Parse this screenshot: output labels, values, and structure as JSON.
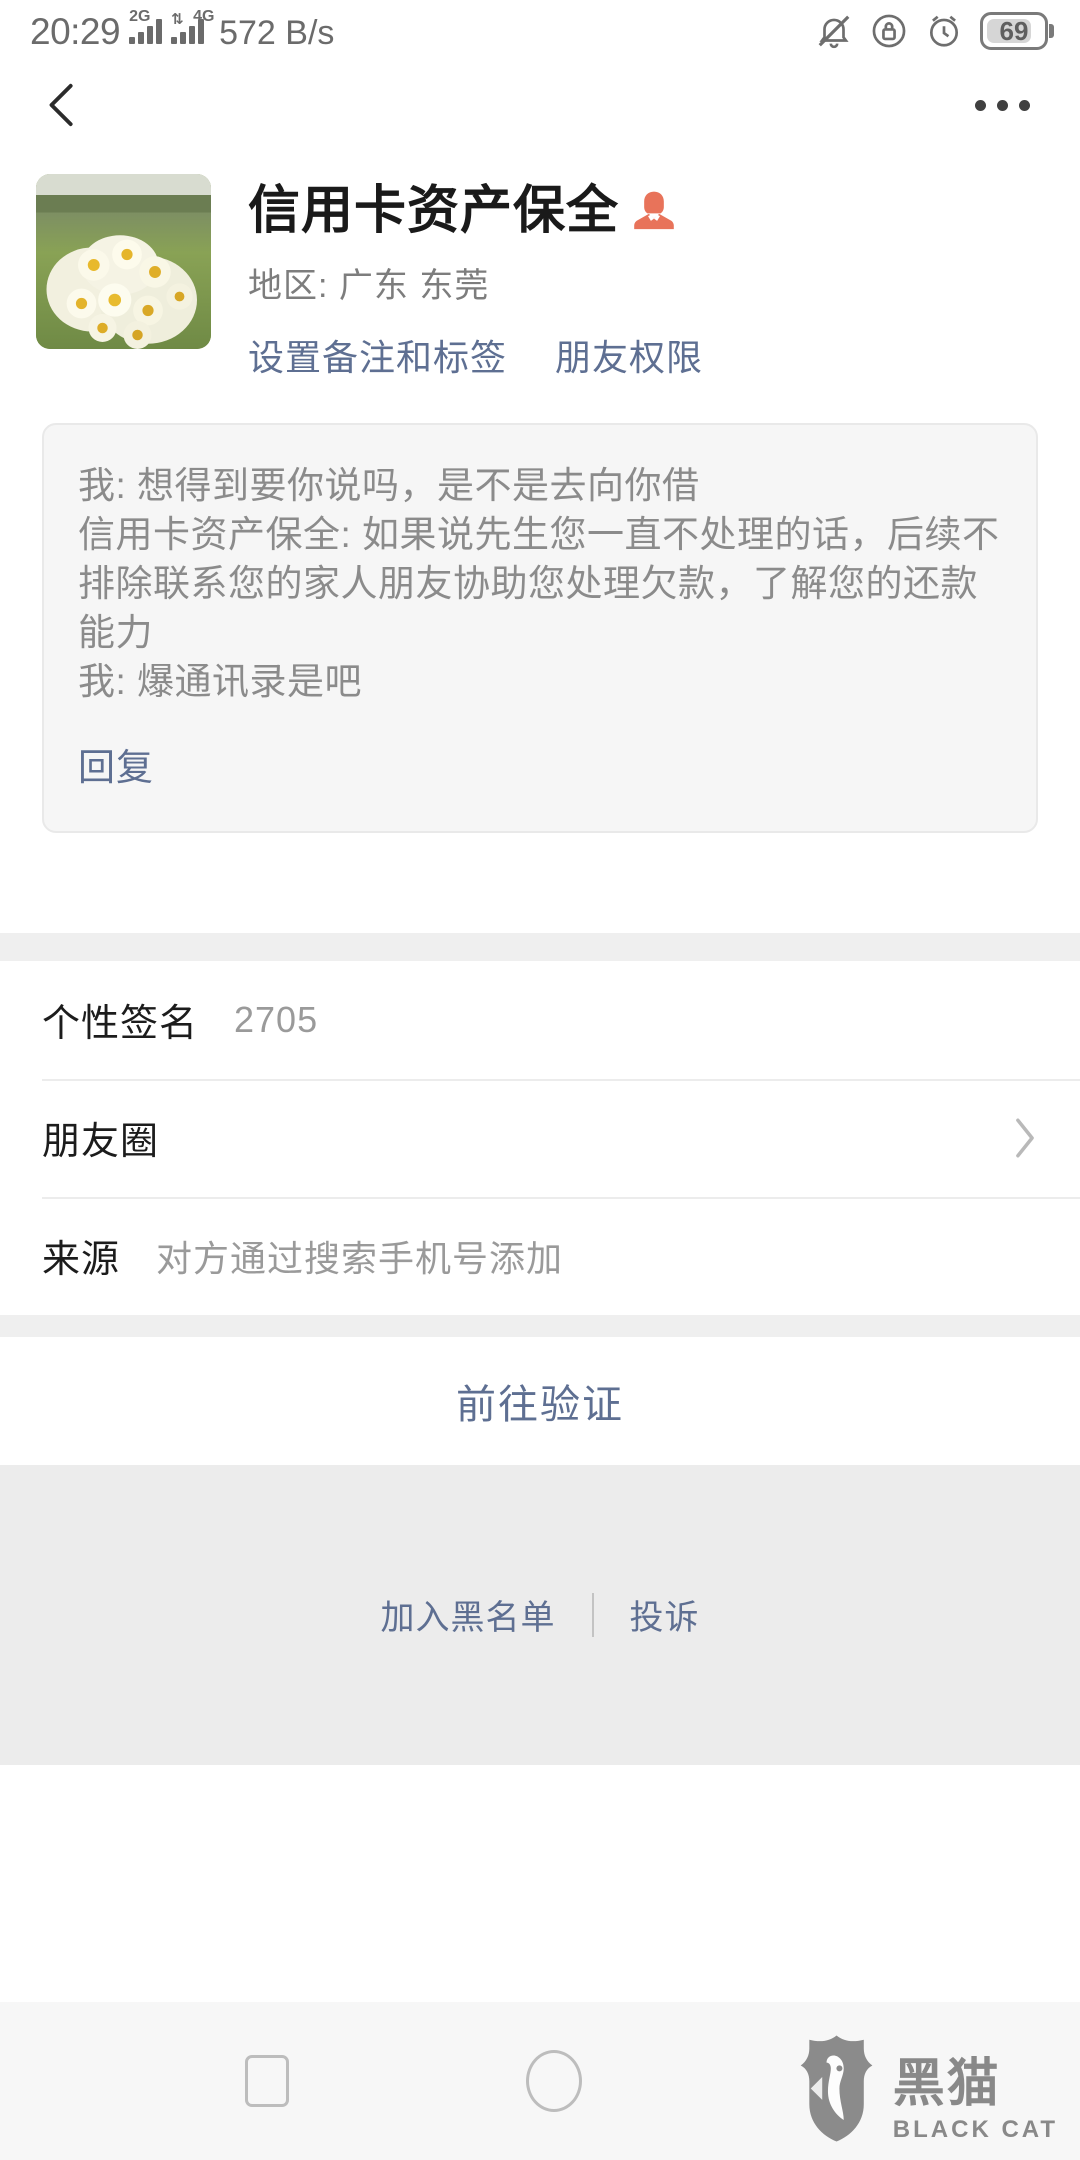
{
  "status_bar": {
    "time": "20:29",
    "network_1": "2G",
    "network_2": "4G",
    "data_speed": "572 B/s",
    "battery_percent": "69",
    "icons": [
      "bell-muted-icon",
      "rotation-lock-icon",
      "alarm-clock-icon",
      "battery-icon"
    ]
  },
  "nav": {
    "back_icon": "chevron-left-icon",
    "more_icon": "more-options-icon"
  },
  "profile": {
    "avatar_alt": "white and yellow daisy flowers on grass",
    "name": "信用卡资产保全",
    "gender_icon": "person-bust-icon",
    "gender_icon_color": "#e8735a",
    "region_label": "地区:",
    "region_value": "广东  东莞",
    "links": [
      {
        "label": "设置备注和标签",
        "name": "set-remark-and-tags-link"
      },
      {
        "label": "朋友权限",
        "name": "friend-permissions-link"
      }
    ]
  },
  "quote_card": {
    "lines": [
      "我: 想得到要你说吗，是不是去向你借",
      "信用卡资产保全: 如果说先生您一直不处理的话，后续不排除联系您的家人朋友协助您处理欠款，了解您的还款能力",
      "我: 爆通讯录是吧"
    ],
    "reply_label": "回复"
  },
  "info_rows": [
    {
      "label": "个性签名",
      "value": "2705",
      "chevron": false,
      "name": "signature-row"
    },
    {
      "label": "朋友圈",
      "value": "",
      "chevron": true,
      "name": "moments-row"
    },
    {
      "label": "来源",
      "value": "对方通过搜索手机号添加",
      "chevron": false,
      "name": "source-row"
    }
  ],
  "verify_button": {
    "label": "前往验证"
  },
  "bottom_actions": [
    {
      "label": "加入黑名单",
      "name": "add-to-blacklist-button"
    },
    {
      "label": "投诉",
      "name": "report-button"
    }
  ],
  "android_nav": {
    "square_icon": "square-recents-icon",
    "circle_icon": "circle-home-icon"
  },
  "watermark": {
    "cn": "黑猫",
    "en": "BLACK CAT",
    "icon": "cat-shield-logo-icon"
  },
  "colors": {
    "link_blue": "#5e6f92",
    "grey_bg": "#ececec",
    "card_bg": "#f6f6f6",
    "accent_orange": "#e8735a"
  }
}
